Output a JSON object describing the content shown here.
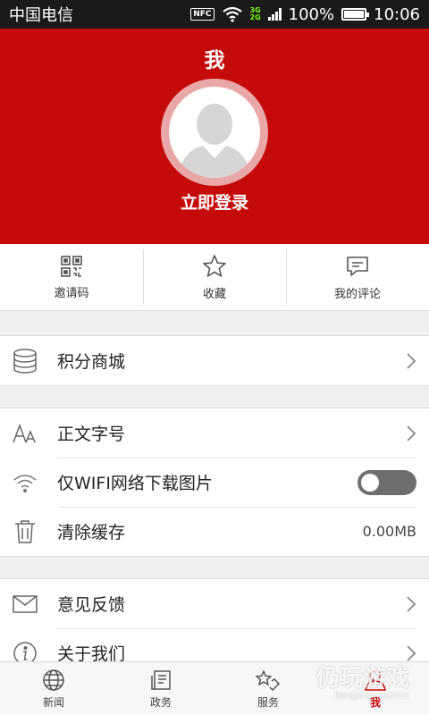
{
  "status": {
    "carrier": "中国电信",
    "nfc": "NFC",
    "net_top": "3G",
    "net_bottom": "2G",
    "battery": "100%",
    "time": "10:06"
  },
  "header": {
    "title": "我",
    "login": "立即登录"
  },
  "quick": [
    {
      "label": "邀请码",
      "icon": "qrcode-icon"
    },
    {
      "label": "收藏",
      "icon": "star-icon"
    },
    {
      "label": "我的评论",
      "icon": "comment-icon"
    }
  ],
  "settings": {
    "points_mall": "积分商城",
    "font_size": "正文字号",
    "wifi_only": "仅WIFI网络下载图片",
    "wifi_only_on": false,
    "clear_cache": "清除缓存",
    "cache_size": "0.00MB",
    "feedback": "意见反馈",
    "about": "关于我们"
  },
  "tabs": [
    {
      "label": "新闻",
      "icon": "globe-icon"
    },
    {
      "label": "政务",
      "icon": "document-icon"
    },
    {
      "label": "服务",
      "icon": "service-icon"
    },
    {
      "label": "我",
      "icon": "person-icon",
      "active": true
    }
  ],
  "watermark": {
    "text": "仍玩游戏",
    "sub": "Rengwan Games"
  },
  "colors": {
    "brand": "#c50a0a"
  }
}
